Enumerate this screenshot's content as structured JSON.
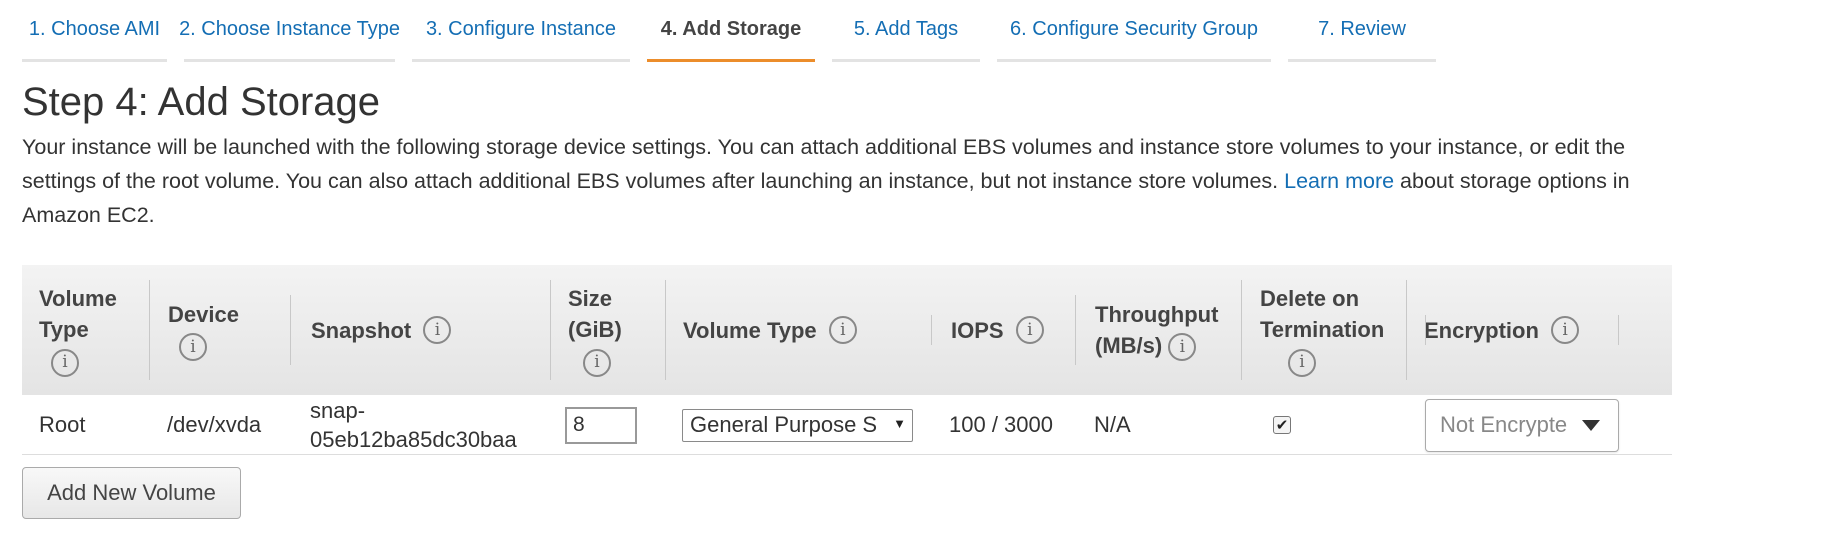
{
  "tabs": [
    {
      "label": "1. Choose AMI"
    },
    {
      "label": "2. Choose Instance Type"
    },
    {
      "label": "3. Configure Instance"
    },
    {
      "label": "4. Add Storage"
    },
    {
      "label": "5. Add Tags"
    },
    {
      "label": "6. Configure Security Group"
    },
    {
      "label": "7. Review"
    }
  ],
  "page": {
    "title": "Step 4: Add Storage",
    "desc_before": "Your instance will be launched with the following storage device settings. You can attach additional EBS volumes and instance store volumes to your instance, or edit the settings of the root volume. You can also attach additional EBS volumes after launching an instance, but not instance store volumes.",
    "learn_more": "Learn more",
    "desc_after": "about storage options in Amazon EC2."
  },
  "table": {
    "headers": {
      "volume_type_a": "Volume",
      "volume_type_b": "Type",
      "device": "Device",
      "snapshot": "Snapshot",
      "size_a": "Size",
      "size_b": "(GiB)",
      "vol_type": "Volume Type",
      "iops": "IOPS",
      "throughput_a": "Throughput",
      "throughput_b": "(MB/s)",
      "delete_a": "Delete on",
      "delete_b": "Termination",
      "encryption": "Encryption"
    },
    "row": {
      "volume_type": "Root",
      "device": "/dev/xvda",
      "snapshot_a": "snap-",
      "snapshot_b": "05eb12ba85dc30baa",
      "size": "8",
      "vol_type": "General Purpose S",
      "iops": "100 / 3000",
      "throughput": "N/A",
      "delete_checked": "✔",
      "encryption": "Not Encrypte"
    }
  },
  "buttons": {
    "add_volume": "Add New Volume"
  },
  "icons": {
    "info": "i"
  }
}
